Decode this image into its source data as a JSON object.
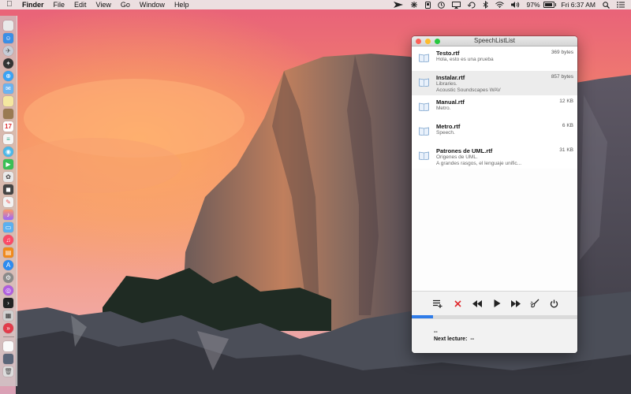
{
  "menubar": {
    "app_name": "Finder",
    "items": [
      "File",
      "Edit",
      "View",
      "Go",
      "Window",
      "Help"
    ],
    "battery_percent": "97%",
    "battery_level": 0.97,
    "clock": "Fri 6:37 AM",
    "status_icons": [
      "cursor-arrow-icon",
      "bluetooth-icon",
      "drive-icon",
      "timer-icon",
      "airplay-icon",
      "time-machine-icon",
      "bluetooth-icon",
      "wifi-icon",
      "volume-icon"
    ]
  },
  "window": {
    "title": "SpeechListList",
    "files": [
      {
        "name": "Testo.rtf",
        "size": "369 bytes",
        "lines": [
          "Hola, esto es una prueba"
        ],
        "selected": false
      },
      {
        "name": "Instalar.rtf",
        "size": "857 bytes",
        "lines": [
          "Libraries.",
          "Acoustic Soundscapes WAV"
        ],
        "selected": true
      },
      {
        "name": "Manual.rtf",
        "size": "12 KB",
        "lines": [
          "Metro."
        ],
        "selected": false
      },
      {
        "name": "Metro.rtf",
        "size": "6 KB",
        "lines": [
          "Speech."
        ],
        "selected": false
      },
      {
        "name": "Patrones de UML.rtf",
        "size": "31 KB",
        "lines": [
          "Origenes de UML.",
          "A grandes rasgos, el lenguaje unific..."
        ],
        "selected": false
      }
    ],
    "controls": [
      "playlist-icon",
      "stop-icon",
      "rewind-icon",
      "play-icon",
      "fast-forward-icon",
      "brush-icon",
      "power-icon"
    ],
    "progress": 0.13,
    "current_lecture": "--",
    "next_lecture_label": "Next lecture:",
    "next_lecture_value": "--"
  },
  "colors": {
    "accent": "#2f7ce9",
    "stop": "#e0292d",
    "close": "#fc5f57",
    "minimize": "#fdbc2e",
    "zoom": "#28c840"
  }
}
